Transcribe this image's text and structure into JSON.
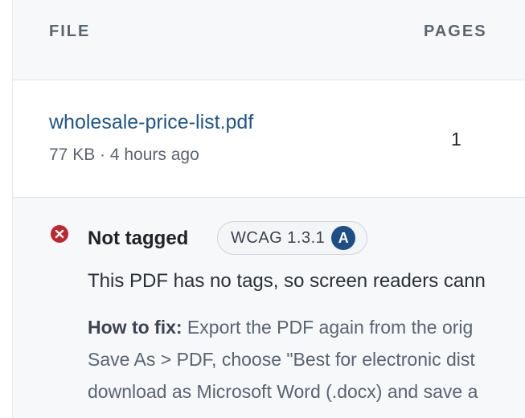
{
  "table": {
    "headers": {
      "file": "FILE",
      "pages": "PAGES"
    },
    "rows": [
      {
        "file_name": "wholesale-price-list.pdf",
        "file_meta": "77 KB · 4 hours ago",
        "pages": "1"
      }
    ]
  },
  "issue": {
    "icon": "error-circle-icon",
    "title": "Not tagged",
    "badge": {
      "text": "WCAG 1.3.1",
      "level": "A"
    },
    "description": "This PDF has no tags, so screen readers cann",
    "fix_label": "How to fix:",
    "fix_lines": [
      " Export the PDF again from the orig",
      "Save As > PDF, choose \"Best for electronic dist",
      "download as Microsoft Word (.docx) and save a"
    ]
  },
  "colors": {
    "link": "#1f5689",
    "error": "#c0262d",
    "badge_level": "#1d4f86",
    "header_bg": "#f6f8fa"
  }
}
